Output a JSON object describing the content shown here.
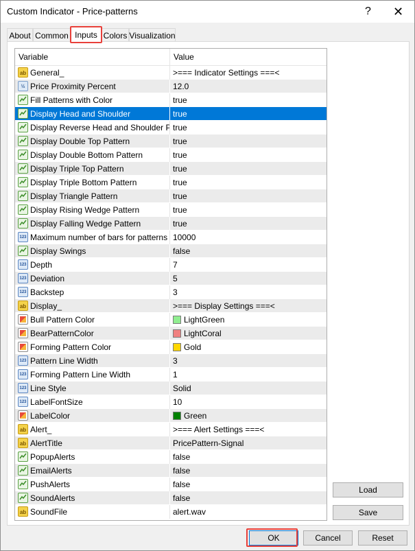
{
  "window": {
    "title": "Custom Indicator - Price-patterns",
    "help_glyph": "?",
    "close_glyph": "✕"
  },
  "tabs": [
    {
      "label": "About"
    },
    {
      "label": "Common"
    },
    {
      "label": "Inputs",
      "active": true
    },
    {
      "label": "Colors"
    },
    {
      "label": "Visualization"
    }
  ],
  "grid": {
    "header_variable": "Variable",
    "header_value": "Value",
    "rows": [
      {
        "icon": "ab",
        "label": "General_",
        "value": ">=== Indicator Settings ===<"
      },
      {
        "icon": "half",
        "label": "Price Proximity Percent",
        "value": "12.0"
      },
      {
        "icon": "bool",
        "label": "Fill Patterns with Color",
        "value": "true"
      },
      {
        "icon": "bool",
        "label": "Display Head and Shoulder",
        "value": "true",
        "selected": true
      },
      {
        "icon": "bool",
        "label": "Display Reverse Head and Shoulder Pat...",
        "value": "true"
      },
      {
        "icon": "bool",
        "label": "Display Double Top Pattern",
        "value": "true"
      },
      {
        "icon": "bool",
        "label": "Display Double Bottom Pattern",
        "value": "true"
      },
      {
        "icon": "bool",
        "label": "Display Triple Top Pattern",
        "value": "true"
      },
      {
        "icon": "bool",
        "label": "Display Triple Bottom Pattern",
        "value": "true"
      },
      {
        "icon": "bool",
        "label": "Display Triangle Pattern",
        "value": "true"
      },
      {
        "icon": "bool",
        "label": "Display Rising Wedge Pattern",
        "value": "true"
      },
      {
        "icon": "bool",
        "label": "Display Falling Wedge Pattern",
        "value": "true"
      },
      {
        "icon": "int",
        "label": "Maximum number of bars for patterns se...",
        "value": "10000"
      },
      {
        "icon": "bool",
        "label": "Display Swings",
        "value": "false"
      },
      {
        "icon": "int",
        "label": "Depth",
        "value": "7"
      },
      {
        "icon": "int",
        "label": "Deviation",
        "value": "5"
      },
      {
        "icon": "int",
        "label": "Backstep",
        "value": "3"
      },
      {
        "icon": "ab",
        "label": "Display_",
        "value": ">=== Display Settings ===<"
      },
      {
        "icon": "color",
        "label": "Bull Pattern Color",
        "value": "LightGreen",
        "swatch": "#90ee90"
      },
      {
        "icon": "color",
        "label": "BearPatternColor",
        "value": "LightCoral",
        "swatch": "#f08080"
      },
      {
        "icon": "color",
        "label": "Forming Pattern Color",
        "value": "Gold",
        "swatch": "#ffd700"
      },
      {
        "icon": "int",
        "label": "Pattern Line Width",
        "value": "3"
      },
      {
        "icon": "int",
        "label": "Forming Pattern Line Width",
        "value": "1"
      },
      {
        "icon": "style",
        "label": "Line Style",
        "value": "Solid"
      },
      {
        "icon": "int",
        "label": "LabelFontSize",
        "value": "10"
      },
      {
        "icon": "color",
        "label": "LabelColor",
        "value": "Green",
        "swatch": "#008000"
      },
      {
        "icon": "ab",
        "label": "Alert_",
        "value": ">=== Alert Settings ===<"
      },
      {
        "icon": "ab",
        "label": "AlertTitle",
        "value": "PricePattern-Signal"
      },
      {
        "icon": "bool",
        "label": "PopupAlerts",
        "value": "false"
      },
      {
        "icon": "bool",
        "label": "EmailAlerts",
        "value": "false"
      },
      {
        "icon": "bool",
        "label": "PushAlerts",
        "value": "false"
      },
      {
        "icon": "bool",
        "label": "SoundAlerts",
        "value": "false"
      },
      {
        "icon": "ab",
        "label": "SoundFile",
        "value": "alert.wav"
      }
    ]
  },
  "buttons": {
    "load": "Load",
    "save": "Save",
    "ok": "OK",
    "cancel": "Cancel",
    "reset": "Reset"
  },
  "colors": {
    "selection": "#0078d7",
    "highlight_border": "#e8403a",
    "alt_row": "#ebebeb"
  }
}
